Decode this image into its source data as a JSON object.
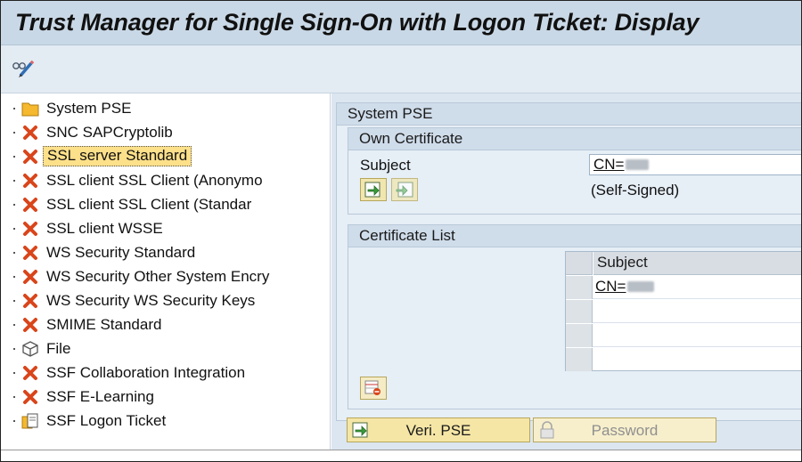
{
  "window": {
    "title": "Trust Manager for Single Sign-On with Logon Ticket: Display"
  },
  "toolbar": {
    "display_change_icon": "glasses-pencil-icon"
  },
  "tree": {
    "items": [
      {
        "label": "System PSE",
        "icon": "folder-icon",
        "selected": false
      },
      {
        "label": "SNC SAPCryptolib",
        "icon": "red-x-icon",
        "selected": false
      },
      {
        "label": "SSL server Standard",
        "icon": "red-x-icon",
        "selected": true
      },
      {
        "label": "SSL client SSL Client (Anonymo",
        "icon": "red-x-icon",
        "selected": false
      },
      {
        "label": "SSL client SSL Client (Standar",
        "icon": "red-x-icon",
        "selected": false
      },
      {
        "label": "SSL client WSSE",
        "icon": "red-x-icon",
        "selected": false
      },
      {
        "label": "WS Security Standard",
        "icon": "red-x-icon",
        "selected": false
      },
      {
        "label": "WS Security Other System Encry",
        "icon": "red-x-icon",
        "selected": false
      },
      {
        "label": "WS Security WS Security Keys",
        "icon": "red-x-icon",
        "selected": false
      },
      {
        "label": "SMIME Standard",
        "icon": "red-x-icon",
        "selected": false
      },
      {
        "label": "File",
        "icon": "cube-icon",
        "selected": false
      },
      {
        "label": "SSF Collaboration Integration",
        "icon": "red-x-icon",
        "selected": false
      },
      {
        "label": "SSF E-Learning",
        "icon": "red-x-icon",
        "selected": false
      },
      {
        "label": "SSF Logon Ticket",
        "icon": "ticket-icon",
        "selected": false
      }
    ]
  },
  "detail": {
    "section_title": "System PSE",
    "own_cert": {
      "title": "Own Certificate",
      "subject_label": "Subject",
      "subject_value": "CN=",
      "issuer_value": "(Self-Signed)"
    },
    "cert_list": {
      "title": "Certificate List",
      "column_subject": "Subject",
      "rows": [
        "CN=",
        "",
        "",
        ""
      ]
    },
    "buttons": {
      "veri_pse": "Veri. PSE",
      "password": "Password"
    }
  },
  "colors": {
    "title_bar": "#c9d8e6",
    "panel": "#dbe6f1",
    "button": "#f5e6a6",
    "selection": "#fde08a",
    "error_x": "#d9451b"
  }
}
